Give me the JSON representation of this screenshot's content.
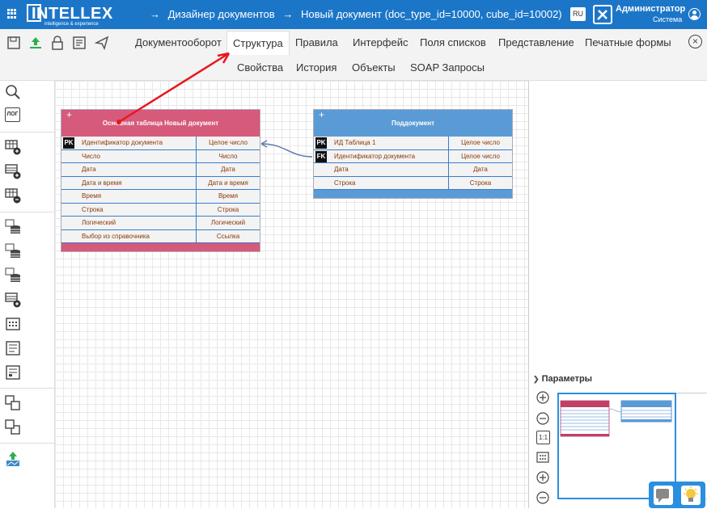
{
  "header": {
    "logo_text": "INTELLEX",
    "logo_sub": "intelligence & experience",
    "breadcrumbs": [
      "→",
      "Дизайнер документов",
      "→",
      "Новый документ (doc_type_id=10000, cube_id=10002)"
    ],
    "lang": "RU",
    "user_name": "Администратор",
    "user_sub": "Система"
  },
  "tabs": {
    "row1": [
      "Документооборот",
      "Структура",
      "Правила",
      "Интерфейс",
      "Поля списков",
      "Представление",
      "Печатные формы"
    ],
    "row2": [
      "Свойства",
      "История",
      "Объекты",
      "SOAP Запросы"
    ],
    "active": "Структура",
    "close": "×"
  },
  "sidebar": {
    "log_label": "ЛОГ"
  },
  "main_table": {
    "plus": "+",
    "title": "Основная таблица Новый документ",
    "color": "#d65a7a",
    "rows": [
      {
        "key": "PK",
        "name": "Идентификатор документа",
        "type": "Целое число"
      },
      {
        "key": "",
        "name": "Число",
        "type": "Число"
      },
      {
        "key": "",
        "name": "Дата",
        "type": "Дата"
      },
      {
        "key": "",
        "name": "Дата и время",
        "type": "Дата и время"
      },
      {
        "key": "",
        "name": "Время",
        "type": "Время"
      },
      {
        "key": "",
        "name": "Строка",
        "type": "Строка"
      },
      {
        "key": "",
        "name": "Логический",
        "type": "Логический"
      },
      {
        "key": "",
        "name": "Выбор из справочника",
        "type": "Ссылка"
      }
    ]
  },
  "sub_table": {
    "plus": "+",
    "title": "Поддокумент",
    "color": "#5b9bd5",
    "rows": [
      {
        "key": "PK",
        "name": "ИД Таблица 1",
        "type": "Целое число"
      },
      {
        "key": "FK",
        "name": "Идентификатор документа",
        "type": "Целое число"
      },
      {
        "key": "",
        "name": "Дата",
        "type": "Дата"
      },
      {
        "key": "",
        "name": "Строка",
        "type": "Строка"
      }
    ]
  },
  "right_panel": {
    "params_label": "Параметры",
    "zoom_label": "1:1"
  },
  "colors": {
    "header_bg": "#1c76c8",
    "accent": "#2b8fe0",
    "annotation": "#e8171f"
  }
}
